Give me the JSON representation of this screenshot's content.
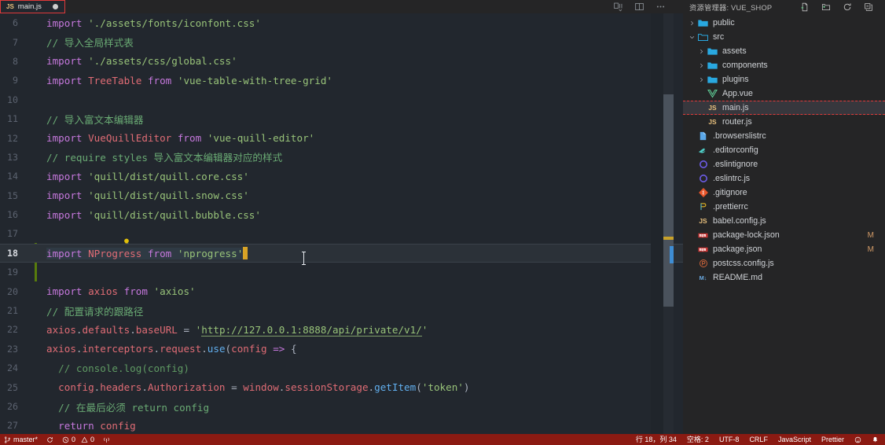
{
  "window": {
    "editor_tab": {
      "icon": "js-file-icon",
      "name": "main.js",
      "dirty": true
    },
    "editor_actions": [
      {
        "name": "split-editor-right-icon",
        "label": "Split Editor Right"
      },
      {
        "name": "toggle-panel-layout-icon",
        "label": "Editor Layout"
      },
      {
        "name": "more-actions-icon",
        "label": "..."
      }
    ]
  },
  "editor": {
    "language": "JavaScript",
    "active_line": 18,
    "first_visible_line": 6,
    "lines": [
      {
        "n": 6,
        "text": "import './assets/fonts/iconfont.css'"
      },
      {
        "n": 7,
        "text": "// 导入全局样式表"
      },
      {
        "n": 8,
        "text": "import './assets/css/global.css'"
      },
      {
        "n": 9,
        "text": "import TreeTable from 'vue-table-with-tree-grid'"
      },
      {
        "n": 10,
        "text": ""
      },
      {
        "n": 11,
        "text": "// 导入富文本编辑器"
      },
      {
        "n": 12,
        "text": "import VueQuillEditor from 'vue-quill-editor'"
      },
      {
        "n": 13,
        "text": "// require styles 导入富文本编辑器对应的样式"
      },
      {
        "n": 14,
        "text": "import 'quill/dist/quill.core.css'"
      },
      {
        "n": 15,
        "text": "import 'quill/dist/quill.snow.css'"
      },
      {
        "n": 16,
        "text": "import 'quill/dist/quill.bubble.css'"
      },
      {
        "n": 17,
        "text": ""
      },
      {
        "n": 18,
        "text": "import NProgress from 'nprogress'"
      },
      {
        "n": 19,
        "text": ""
      },
      {
        "n": 20,
        "text": "import axios from 'axios'"
      },
      {
        "n": 21,
        "text": "// 配置请求的跟路径"
      },
      {
        "n": 22,
        "text": "axios.defaults.baseURL = 'http://127.0.0.1:8888/api/private/v1/'"
      },
      {
        "n": 23,
        "text": "axios.interceptors.request.use(config => {"
      },
      {
        "n": 24,
        "text": "  // console.log(config)"
      },
      {
        "n": 25,
        "text": "  config.headers.Authorization = window.sessionStorage.getItem('token')"
      },
      {
        "n": 26,
        "text": "  // 在最后必须 return config"
      },
      {
        "n": 27,
        "text": "  return config"
      }
    ],
    "quick_fix_icon": "lightbulb-icon",
    "link_url": "http://127.0.0.1:8888/api/private/v1/"
  },
  "sidebar": {
    "title": "资源管理器: VUE_SHOP",
    "actions": [
      {
        "name": "new-file-icon",
        "label": "新建文件"
      },
      {
        "name": "new-folder-icon",
        "label": "新建文件夹"
      },
      {
        "name": "refresh-icon",
        "label": "刷新"
      },
      {
        "name": "collapse-all-icon",
        "label": "全部折叠"
      }
    ],
    "tree": [
      {
        "label": "public",
        "type": "folder",
        "depth": 0,
        "expanded": false,
        "icon": "folder-icon"
      },
      {
        "label": "src",
        "type": "folder",
        "depth": 0,
        "expanded": true,
        "icon": "folder-open-icon"
      },
      {
        "label": "assets",
        "type": "folder",
        "depth": 1,
        "expanded": false,
        "icon": "folder-icon"
      },
      {
        "label": "components",
        "type": "folder",
        "depth": 1,
        "expanded": false,
        "icon": "folder-icon"
      },
      {
        "label": "plugins",
        "type": "folder",
        "depth": 1,
        "expanded": false,
        "icon": "folder-icon"
      },
      {
        "label": "App.vue",
        "type": "file",
        "depth": 1,
        "icon": "vue-file-icon"
      },
      {
        "label": "main.js",
        "type": "file",
        "depth": 1,
        "icon": "js-file-icon",
        "selected": true
      },
      {
        "label": "router.js",
        "type": "file",
        "depth": 1,
        "icon": "js-file-icon"
      },
      {
        "label": ".browserslistrc",
        "type": "file",
        "depth": 0,
        "icon": "text-file-icon"
      },
      {
        "label": ".editorconfig",
        "type": "file",
        "depth": 0,
        "icon": "editorconfig-icon"
      },
      {
        "label": ".eslintignore",
        "type": "file",
        "depth": 0,
        "icon": "eslint-icon"
      },
      {
        "label": ".eslintrc.js",
        "type": "file",
        "depth": 0,
        "icon": "eslint-icon"
      },
      {
        "label": ".gitignore",
        "type": "file",
        "depth": 0,
        "icon": "git-icon"
      },
      {
        "label": ".prettierrc",
        "type": "file",
        "depth": 0,
        "icon": "prettier-icon"
      },
      {
        "label": "babel.config.js",
        "type": "file",
        "depth": 0,
        "icon": "js-file-icon"
      },
      {
        "label": "package-lock.json",
        "type": "file",
        "depth": 0,
        "icon": "npm-icon",
        "badge": "M"
      },
      {
        "label": "package.json",
        "type": "file",
        "depth": 0,
        "icon": "npm-icon",
        "badge": "M"
      },
      {
        "label": "postcss.config.js",
        "type": "file",
        "depth": 0,
        "icon": "postcss-icon"
      },
      {
        "label": "README.md",
        "type": "file",
        "depth": 0,
        "icon": "markdown-icon"
      }
    ]
  },
  "statusbar": {
    "background": "#8b1a12",
    "branch": "master*",
    "sync_icon": "sync-icon",
    "errors": "0",
    "warnings": "0",
    "ports_icon": "radio-tower-icon",
    "cursor_position": "行 18，列 34",
    "indentation": "空格: 2",
    "encoding": "UTF-8",
    "eol": "CRLF",
    "language_mode": "JavaScript",
    "formatter": "Prettier",
    "feedback_icon": "smiley-icon",
    "notifications_icon": "bell-icon"
  }
}
